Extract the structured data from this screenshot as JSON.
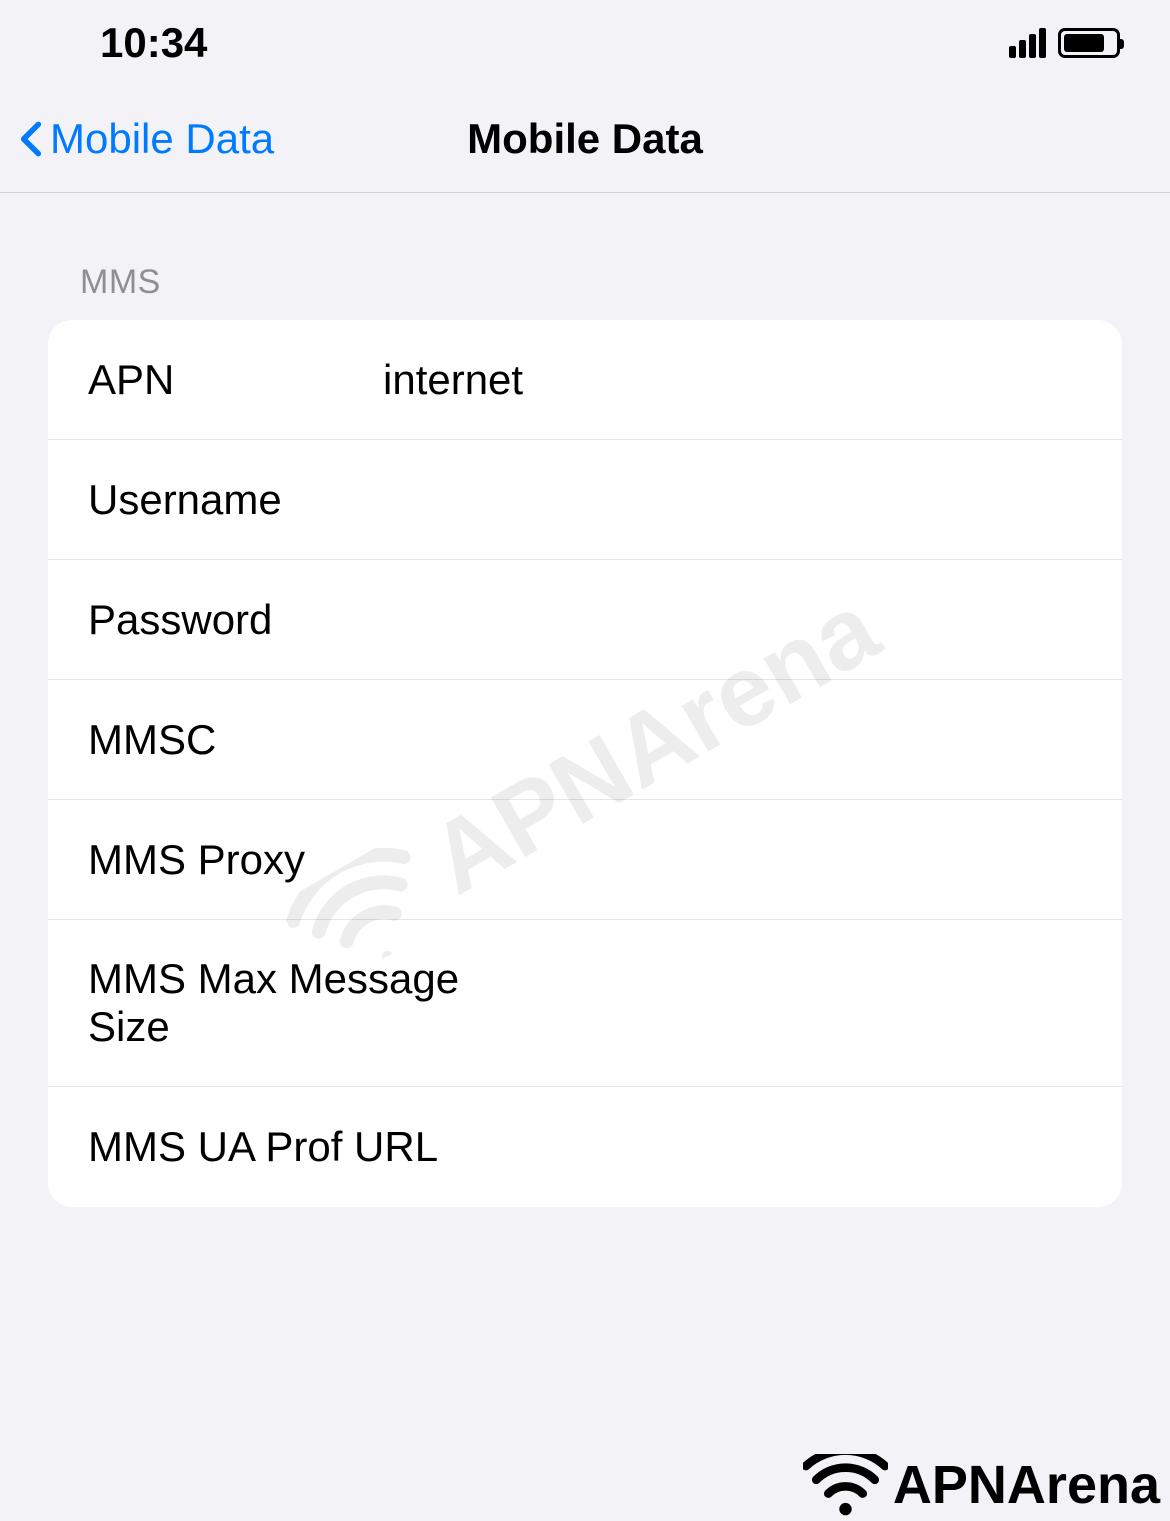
{
  "statusBar": {
    "time": "10:34"
  },
  "navBar": {
    "backLabel": "Mobile Data",
    "title": "Mobile Data"
  },
  "section": {
    "header": "MMS",
    "fields": {
      "apn": {
        "label": "APN",
        "value": "internet"
      },
      "username": {
        "label": "Username",
        "value": ""
      },
      "password": {
        "label": "Password",
        "value": ""
      },
      "mmsc": {
        "label": "MMSC",
        "value": ""
      },
      "mmsProxy": {
        "label": "MMS Proxy",
        "value": ""
      },
      "mmsMaxSize": {
        "label": "MMS Max Message Size",
        "value": ""
      },
      "mmsUaProf": {
        "label": "MMS UA Prof URL",
        "value": ""
      }
    }
  },
  "watermark": {
    "text": "APNArena"
  }
}
